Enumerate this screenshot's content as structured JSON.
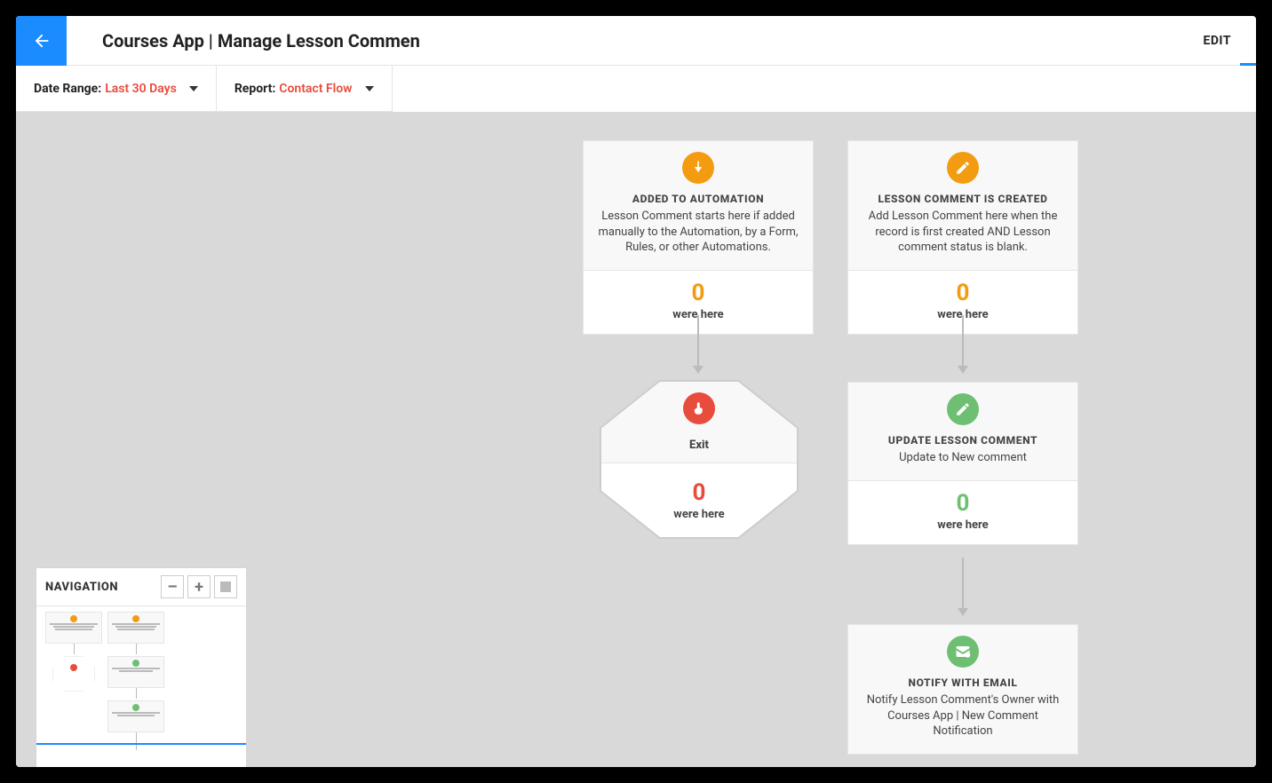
{
  "header": {
    "title": "Courses App | Manage Lesson Commen",
    "edit_label": "EDIT"
  },
  "toolbar": {
    "date_range_label": "Date Range:",
    "date_range_value": "Last 30 Days",
    "report_label": "Report:",
    "report_value": "Contact Flow"
  },
  "nodes": {
    "added": {
      "title": "ADDED TO AUTOMATION",
      "desc": "Lesson Comment starts here if added manually to the Automation, by a Form, Rules, or other Automations.",
      "count": "0",
      "sub": "were here"
    },
    "created": {
      "title": "LESSON COMMENT IS CREATED",
      "desc": "Add Lesson Comment here when the record is first created AND Lesson comment status is blank.",
      "count": "0",
      "sub": "were here"
    },
    "exit": {
      "title": "Exit",
      "count": "0",
      "sub": "were here"
    },
    "update": {
      "title": "UPDATE LESSON COMMENT",
      "desc": "Update  to New comment",
      "count": "0",
      "sub": "were here"
    },
    "notify": {
      "title": "NOTIFY WITH EMAIL",
      "desc": "Notify Lesson Comment's Owner with Courses App | New Comment Notification"
    }
  },
  "nav": {
    "title": "NAVIGATION",
    "minus": "–",
    "plus": "+"
  },
  "colors": {
    "orange": "#f39c12",
    "green": "#6fbf73",
    "red": "#e74c3c",
    "blue": "#1a8cff"
  }
}
